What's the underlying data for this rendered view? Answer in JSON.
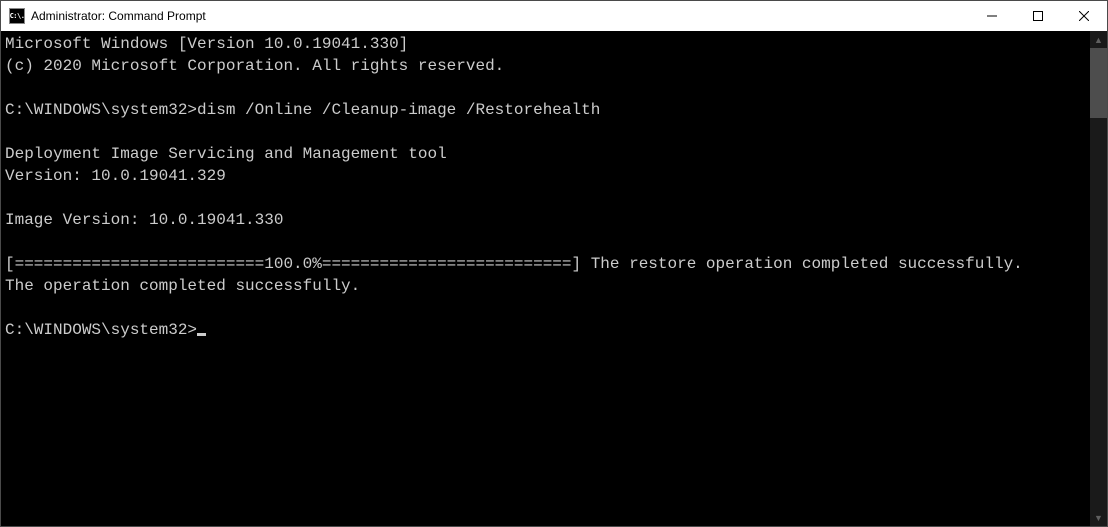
{
  "titlebar": {
    "icon_text": "C:\\.",
    "title": "Administrator: Command Prompt"
  },
  "console": {
    "line1": "Microsoft Windows [Version 10.0.19041.330]",
    "line2": "(c) 2020 Microsoft Corporation. All rights reserved.",
    "blank1": "",
    "prompt1": "C:\\WINDOWS\\system32>",
    "command1": "dism /Online /Cleanup-image /Restorehealth",
    "blank2": "",
    "tool_line1": "Deployment Image Servicing and Management tool",
    "tool_line2": "Version: 10.0.19041.329",
    "blank3": "",
    "image_version": "Image Version: 10.0.19041.330",
    "blank4": "",
    "progress": "[==========================100.0%==========================] The restore operation completed successfully.",
    "completed": "The operation completed successfully.",
    "blank5": "",
    "prompt2": "C:\\WINDOWS\\system32>"
  }
}
